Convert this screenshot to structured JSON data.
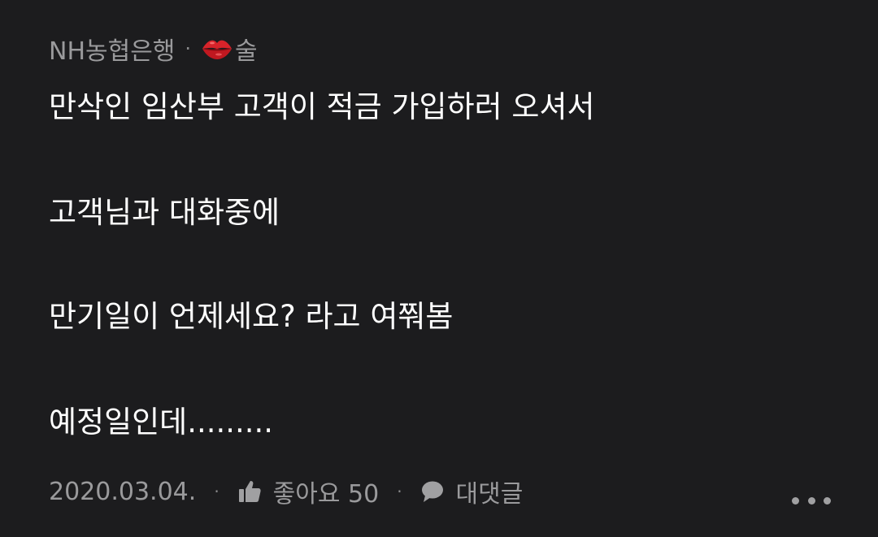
{
  "post": {
    "author": "NH농협은행",
    "separator": "·",
    "tag_icon": "lips-icon",
    "tag_label": "술",
    "lines": [
      "만삭인 임산부 고객이 적금 가입하러 오셔서",
      "고객님과 대화중에",
      "만기일이 언제세요? 라고 여쭤봄",
      "예정일인데........."
    ]
  },
  "footer": {
    "date": "2020.03.04.",
    "separator": "·",
    "like_icon": "thumbs-up-icon",
    "like_label": "좋아요 50",
    "comment_icon": "comment-icon",
    "comment_label": "대댓글",
    "more_icon": "more-horizontal-icon"
  },
  "colors": {
    "background": "#1c1c1e",
    "text": "#ffffff",
    "muted": "#9a9a9c",
    "lips": "#d8232a"
  }
}
